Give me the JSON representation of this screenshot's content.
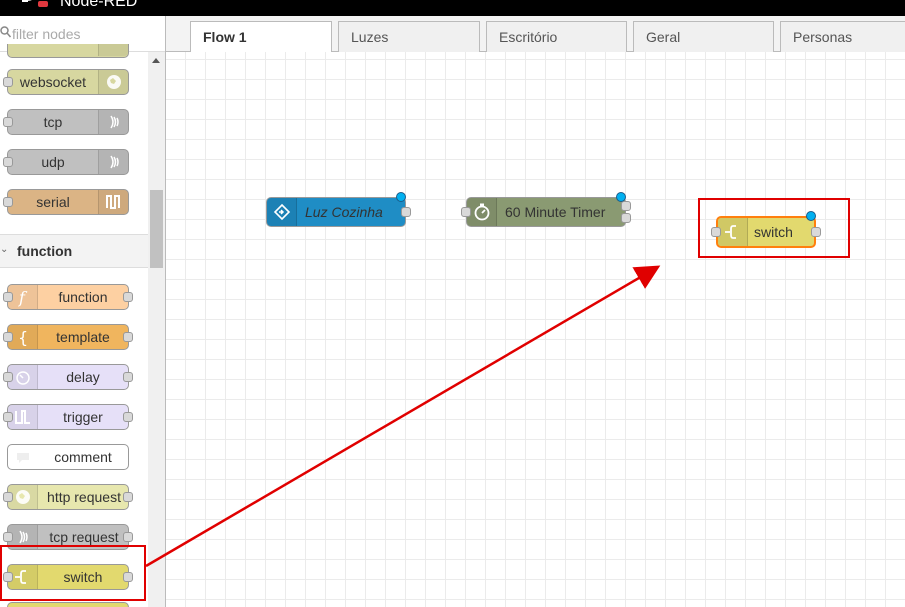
{
  "app": {
    "title": "Node-RED"
  },
  "palette": {
    "filter_placeholder": "filter nodes",
    "nodes_top": [
      {
        "label": "websocket",
        "color": "#d7d7a0",
        "icon": "globe-icon"
      },
      {
        "label": "tcp",
        "color": "#c0c0c0",
        "icon": "bridge-icon"
      },
      {
        "label": "udp",
        "color": "#c0c0c0",
        "icon": "bridge-icon"
      },
      {
        "label": "serial",
        "color": "#dbb485",
        "icon": "serial-icon"
      }
    ],
    "category": {
      "label": "function"
    },
    "nodes_function": [
      {
        "label": "function",
        "color": "#fdd0a2",
        "icon": "function-icon"
      },
      {
        "label": "template",
        "color": "#f0b55e",
        "icon": "template-icon"
      },
      {
        "label": "delay",
        "color": "#e6e0f8",
        "icon": "timer-icon"
      },
      {
        "label": "trigger",
        "color": "#e6e0f8",
        "icon": "trigger-icon"
      },
      {
        "label": "comment",
        "color": "#ffffff",
        "icon": "comment-icon"
      },
      {
        "label": "http request",
        "color": "#e7e7ae",
        "icon": "globe-icon"
      },
      {
        "label": "tcp request",
        "color": "#c0c0c0",
        "icon": "bridge-icon"
      },
      {
        "label": "switch",
        "color": "#e2d96e",
        "icon": "switch-icon"
      }
    ]
  },
  "tabs": [
    {
      "label": "Flow 1",
      "active": true
    },
    {
      "label": "Luzes",
      "active": false
    },
    {
      "label": "Escritório",
      "active": false
    },
    {
      "label": "Geral",
      "active": false
    },
    {
      "label": "Personas",
      "active": false
    }
  ],
  "flow": {
    "nodes": [
      {
        "label": "Luz Cozinha",
        "color": "#1f8dc5",
        "icon": "home-icon"
      },
      {
        "label": "60 Minute Timer",
        "color": "#8a9a72",
        "icon": "stopwatch-icon"
      },
      {
        "label": "switch",
        "color": "#e2d96e",
        "icon": "switch-icon"
      }
    ]
  },
  "colors": {
    "highlight": "#e00000",
    "status": "#00b0f0"
  }
}
